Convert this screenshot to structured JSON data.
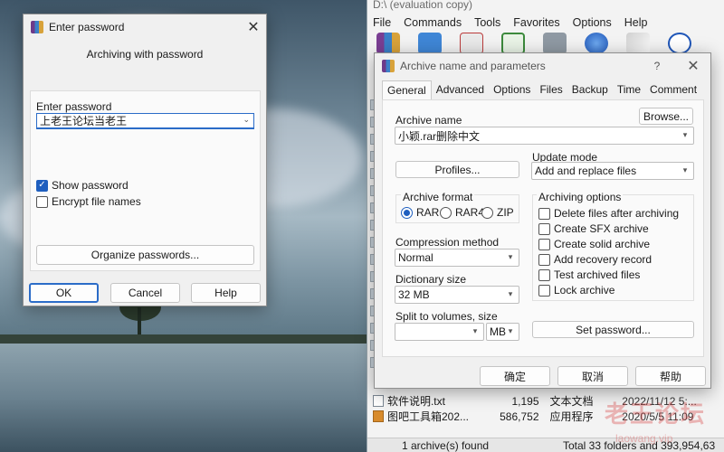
{
  "file_manager": {
    "title": "D:\\ (evaluation copy)",
    "menu": [
      "File",
      "Commands",
      "Tools",
      "Favorites",
      "Options",
      "Help"
    ],
    "toolbar_icons": [
      "add-icon",
      "extract-icon",
      "test-icon",
      "view-icon",
      "delete-icon",
      "find-icon",
      "wizard-icon",
      "info-icon"
    ],
    "files": [
      {
        "name": "软件说明.txt",
        "size": "1,195",
        "type": "文本文档",
        "date": "2022/11/12 5:..."
      },
      {
        "name": "图吧工具箱202...",
        "size": "586,752",
        "type": "应用程序",
        "date": "2020/5/5 11:09"
      }
    ],
    "status_left": "1 archive(s) found",
    "status_right": "Total 33 folders and 393,954,63",
    "watermark": "老王论坛",
    "watermark_sub": "laowang.vip"
  },
  "password_dialog": {
    "title": "Enter password",
    "subtitle": "Archiving with password",
    "field_label": "Enter password",
    "field_value": "上老王论坛当老王",
    "show_password": "Show password",
    "encrypt_names": "Encrypt file names",
    "organize": "Organize passwords...",
    "ok": "OK",
    "cancel": "Cancel",
    "help": "Help"
  },
  "archive_dialog": {
    "title": "Archive name and parameters",
    "help_glyph": "?",
    "tabs": [
      "General",
      "Advanced",
      "Options",
      "Files",
      "Backup",
      "Time",
      "Comment"
    ],
    "archive_name_label": "Archive name",
    "browse": "Browse...",
    "archive_name_value": "小颖.rar删除中文",
    "profiles": "Profiles...",
    "update_mode_label": "Update mode",
    "update_mode_value": "Add and replace files",
    "format_label": "Archive format",
    "formats": [
      "RAR",
      "RAR4",
      "ZIP"
    ],
    "compression_label": "Compression method",
    "compression_value": "Normal",
    "dictionary_label": "Dictionary size",
    "dictionary_value": "32 MB",
    "split_label": "Split to volumes, size",
    "split_unit": "MB",
    "options_label": "Archiving options",
    "options": [
      "Delete files after archiving",
      "Create SFX archive",
      "Create solid archive",
      "Add recovery record",
      "Test archived files",
      "Lock archive"
    ],
    "set_password": "Set password...",
    "ok": "确定",
    "cancel": "取消",
    "help": "帮助"
  }
}
